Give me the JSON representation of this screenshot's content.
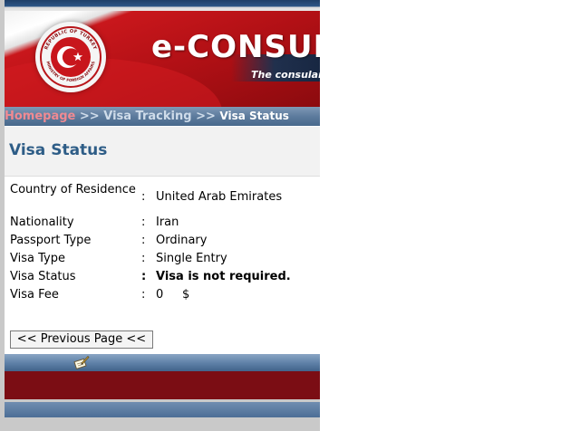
{
  "header": {
    "title": "e-CONSULA",
    "subtitle": "The consular of",
    "seal_top_text": "REPUBLIC OF TURKEY",
    "seal_bottom_text": "MINISTRY OF FOREIGN AFFAIRS",
    "colors": {
      "brand_red": "#c8161c",
      "navy": "#1f3f68"
    }
  },
  "breadcrumb": {
    "home": "Homepage",
    "separator": ">>",
    "tracking": "Visa Tracking",
    "current": "Visa Status"
  },
  "page": {
    "heading": "Visa Status"
  },
  "details": [
    {
      "label": "Country of Residence",
      "colon": ":",
      "value": "United Arab Emirates"
    },
    {
      "label": "Nationality",
      "colon": ":",
      "value": "Iran"
    },
    {
      "label": "Passport Type",
      "colon": ":",
      "value": "Ordinary"
    },
    {
      "label": "Visa Type",
      "colon": ":",
      "value": "Single Entry"
    },
    {
      "label": "Visa Status",
      "colon": ":",
      "value": "Visa is not required."
    },
    {
      "label": "Visa Fee",
      "colon": ":",
      "value": "0",
      "currency": "$"
    }
  ],
  "buttons": {
    "previous": "<< Previous Page <<"
  },
  "footer": {
    "icon": "pen-and-paper-icon"
  }
}
